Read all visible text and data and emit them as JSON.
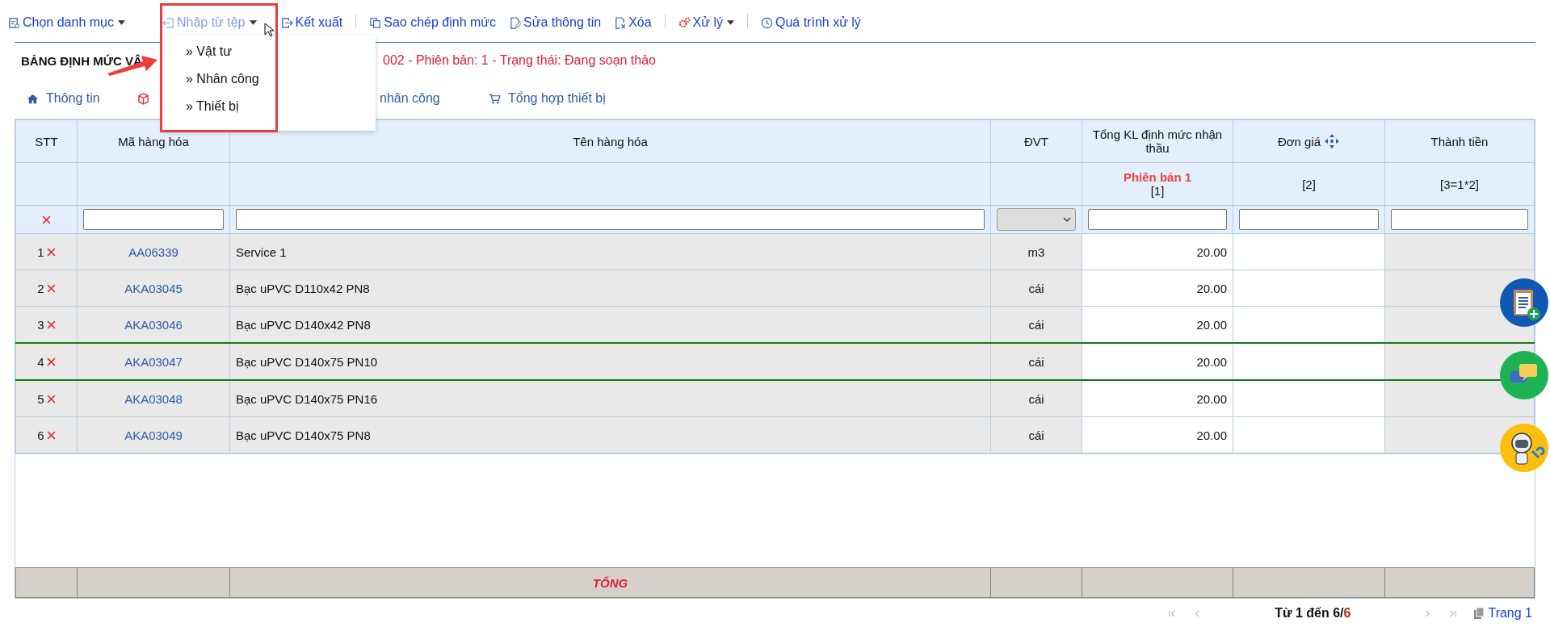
{
  "toolbar": [
    {
      "label": "Chọn danh mục",
      "dropdown": true,
      "expanded": false,
      "divider": false
    },
    {
      "label": "Nhập từ tệp",
      "dropdown": true,
      "expanded": true,
      "divider": false,
      "menu": [
        "» Vật tư",
        "» Nhân công",
        "» Thiết bị"
      ]
    },
    {
      "label": "Kết xuất",
      "dropdown": false,
      "expanded": false,
      "divider": true
    },
    {
      "label": "Sao chép định mức",
      "dropdown": false,
      "expanded": false,
      "divider": false
    },
    {
      "label": "Sửa thông tin",
      "dropdown": false,
      "expanded": false,
      "divider": false
    },
    {
      "label": "Xóa",
      "dropdown": false,
      "expanded": false,
      "divider": true
    },
    {
      "label": "Xử lý",
      "dropdown": true,
      "expanded": false,
      "divider": true
    },
    {
      "label": "Quá trình xử lý",
      "dropdown": false,
      "expanded": false,
      "divider": false
    }
  ],
  "title": {
    "heading": "BẢNG ĐỊNH MỨC VẬ",
    "status": "002 - Phiên bản: 1 - Trạng thái: Đang soạn thảo"
  },
  "tabs": [
    {
      "kind": "home",
      "label": "Thông tin"
    },
    {
      "kind": "box"
    },
    {
      "kind": "text",
      "label": "nhân công"
    },
    {
      "kind": "cart",
      "label": "Tổng hợp thiết bị"
    }
  ],
  "table": {
    "columns": [
      "STT",
      "Mã hàng hóa",
      "Tên hàng hóa",
      "ĐVT",
      "Tổng KL định mức nhận thầu",
      "Đơn giá",
      "Thành tiền"
    ],
    "subheader": {
      "version": "Phiên bản 1",
      "col_5": "[1]",
      "col_6": "[2]",
      "col_7": "[3=1*2]"
    },
    "rows": [
      {
        "stt": "1",
        "code": "AA06339",
        "name": "Service 1",
        "unit": "m3",
        "qty": "20.00",
        "selected": false
      },
      {
        "stt": "2",
        "code": "AKA03045",
        "name": "Bạc uPVC D110x42 PN8",
        "unit": "cái",
        "qty": "20.00",
        "selected": false
      },
      {
        "stt": "3",
        "code": "AKA03046",
        "name": "Bạc uPVC D140x42 PN8",
        "unit": "cái",
        "qty": "20.00",
        "selected": false
      },
      {
        "stt": "4",
        "code": "AKA03047",
        "name": "Bạc uPVC D140x75 PN10",
        "unit": "cái",
        "qty": "20.00",
        "selected": true
      },
      {
        "stt": "5",
        "code": "AKA03048",
        "name": "Bạc uPVC D140x75 PN16",
        "unit": "cái",
        "qty": "20.00",
        "selected": false
      },
      {
        "stt": "6",
        "code": "AKA03049",
        "name": "Bạc uPVC D140x75 PN8",
        "unit": "cái",
        "qty": "20.00",
        "selected": false
      }
    ],
    "footer": "TỔNG"
  },
  "pagination": {
    "range": "Từ 1 đến 6/",
    "total": "6",
    "page": "Trang 1"
  }
}
